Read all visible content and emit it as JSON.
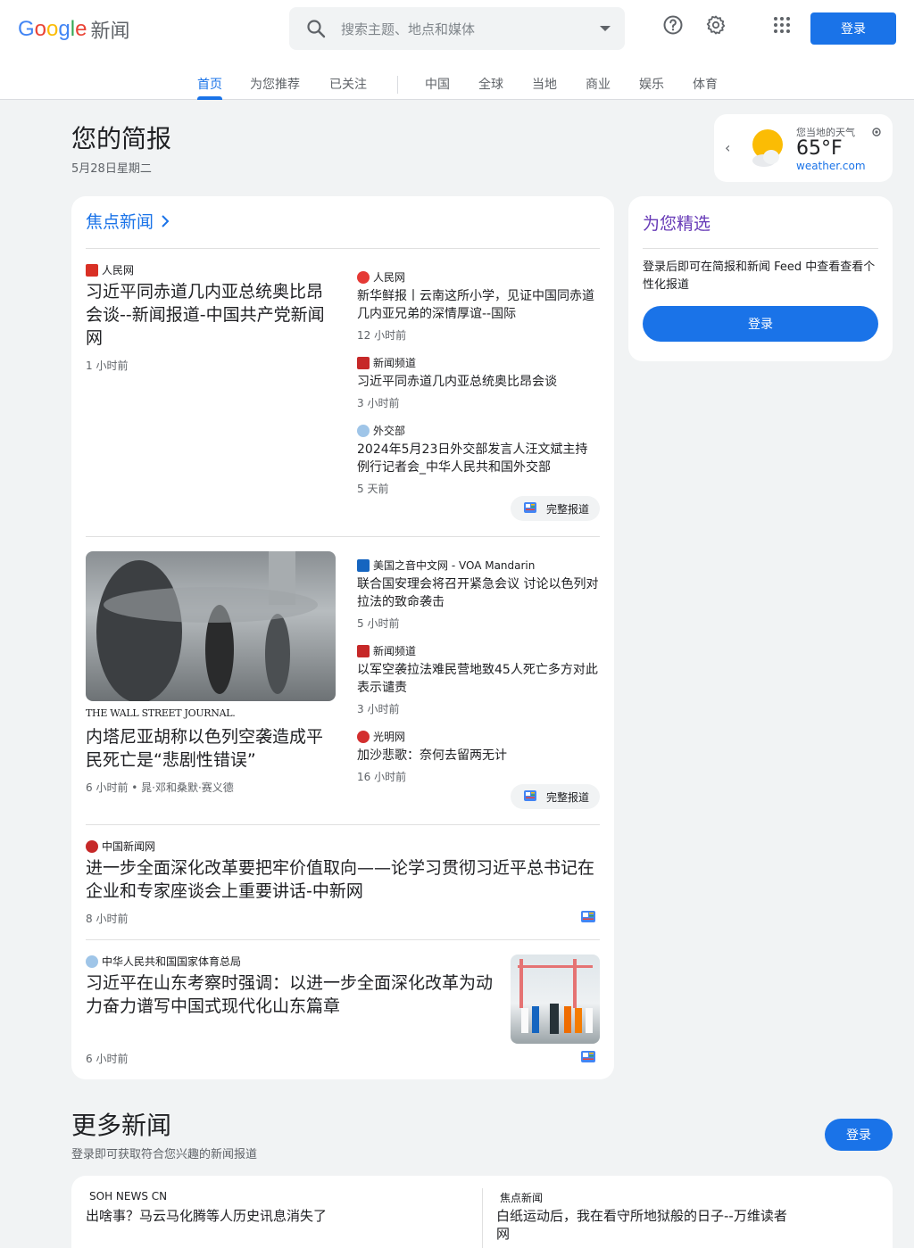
{
  "header": {
    "logo_letters": [
      "G",
      "o",
      "o",
      "g",
      "l",
      "e"
    ],
    "logo_suffix": "新闻",
    "search_placeholder": "搜索主题、地点和媒体",
    "login_label": "登录",
    "icons": [
      "search-icon",
      "help-icon",
      "settings-icon",
      "apps-icon"
    ]
  },
  "tabs": [
    {
      "label": "首页",
      "active": true
    },
    {
      "label": "为您推荐"
    },
    {
      "label": "已关注"
    },
    {
      "label": "中国"
    },
    {
      "label": "全球"
    },
    {
      "label": "当地"
    },
    {
      "label": "商业"
    },
    {
      "label": "娱乐"
    },
    {
      "label": "体育"
    }
  ],
  "briefing": {
    "title": "您的简报",
    "date": "5月28日星期二"
  },
  "weather": {
    "label": "您当地的天气",
    "temp": "65°F",
    "source": "weather.com"
  },
  "focus": {
    "title": "焦点新闻",
    "full_coverage_label": "完整报道",
    "stories": [
      {
        "main": {
          "source": "人民网",
          "headline": "习近平同赤道几内亚总统奥比昂会谈--新闻报道-中国共产党新闻网",
          "time": "1 小时前"
        },
        "related": [
          {
            "source": "人民网",
            "headline": "新华鲜报丨云南这所小学，见证中国同赤道几内亚兄弟的深情厚谊--国际",
            "time": "12 小时前"
          },
          {
            "source": "新闻频道",
            "headline": "习近平同赤道几内亚总统奥比昂会谈",
            "time": "3 小时前"
          },
          {
            "source": "外交部",
            "headline": "2024年5月23日外交部发言人汪文斌主持例行记者会_中华人民共和国外交部",
            "time": "5 天前"
          }
        ]
      },
      {
        "main": {
          "source": "THE WALL STREET JOURNAL.",
          "headline": "内塔尼亚胡称以色列空袭造成平民死亡是“悲剧性错误”",
          "time": "6 小时前 • 晁·邓和桑默·赛义德"
        },
        "related": [
          {
            "source": "美国之音中文网 - VOA Mandarin",
            "headline": "联合国安理会将召开紧急会议 讨论以色列对拉法的致命袭击",
            "time": "5 小时前"
          },
          {
            "source": "新闻频道",
            "headline": "以军空袭拉法难民营地致45人死亡多方对此表示谴责",
            "time": "3 小时前"
          },
          {
            "source": "光明网",
            "headline": "加沙悲歌：奈何去留两无计",
            "time": "16 小时前"
          }
        ]
      },
      {
        "source": "中国新闻网",
        "headline": "进一步全面深化改革要把牢价值取向——论学习贯彻习近平总书记在企业和专家座谈会上重要讲话-中新网",
        "time": "8 小时前"
      },
      {
        "source": "中华人民共和国国家体育总局",
        "headline": "习近平在山东考察时强调：以进一步全面深化改革为动力奋力谱写中国式现代化山东篇章",
        "time": "6 小时前"
      }
    ]
  },
  "picks": {
    "title": "为您精选",
    "desc": "登录后即可在简报和新闻 Feed 中查看查看个性化报道",
    "button": "登录"
  },
  "more": {
    "title": "更多新闻",
    "desc": "登录即可获取符合您兴趣的新闻报道",
    "button": "登录",
    "items": [
      {
        "source": "SOH NEWS CN",
        "headline": "出啥事？马云马化腾等人历史讯息消失了"
      },
      {
        "source": "焦点新闻",
        "headline": "白纸运动后，我在看守所地狱般的日子--万维读者网"
      }
    ]
  },
  "colors": {
    "accent": "#1a73e8",
    "picks_title": "#673ab7"
  }
}
